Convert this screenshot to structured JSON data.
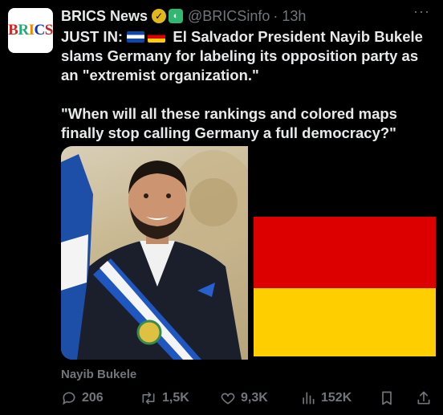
{
  "account": {
    "avatar_text": "BRICS",
    "name": "BRICS News",
    "handle": "@BRICSinfo",
    "time": "· 13h",
    "more_label": "···"
  },
  "post": {
    "prefix": "JUST IN:",
    "line1": "El Salvador President Nayib Bukele slams Germany for labeling its opposition party as an \"extremist organization.\"",
    "quote": "\"When will all these rankings and colored maps finally stop calling Germany a full democracy?\""
  },
  "media": {
    "caption": "Nayib Bukele"
  },
  "actions": {
    "replies": "206",
    "reposts": "1,5K",
    "likes": "9,3K",
    "views": "152K"
  },
  "colors": {
    "background": "#000000",
    "text": "#e7e9ea",
    "muted": "#71767b",
    "verified_gold": "#e2b719",
    "de_red": "#dd0000",
    "de_gold": "#ffce00"
  }
}
